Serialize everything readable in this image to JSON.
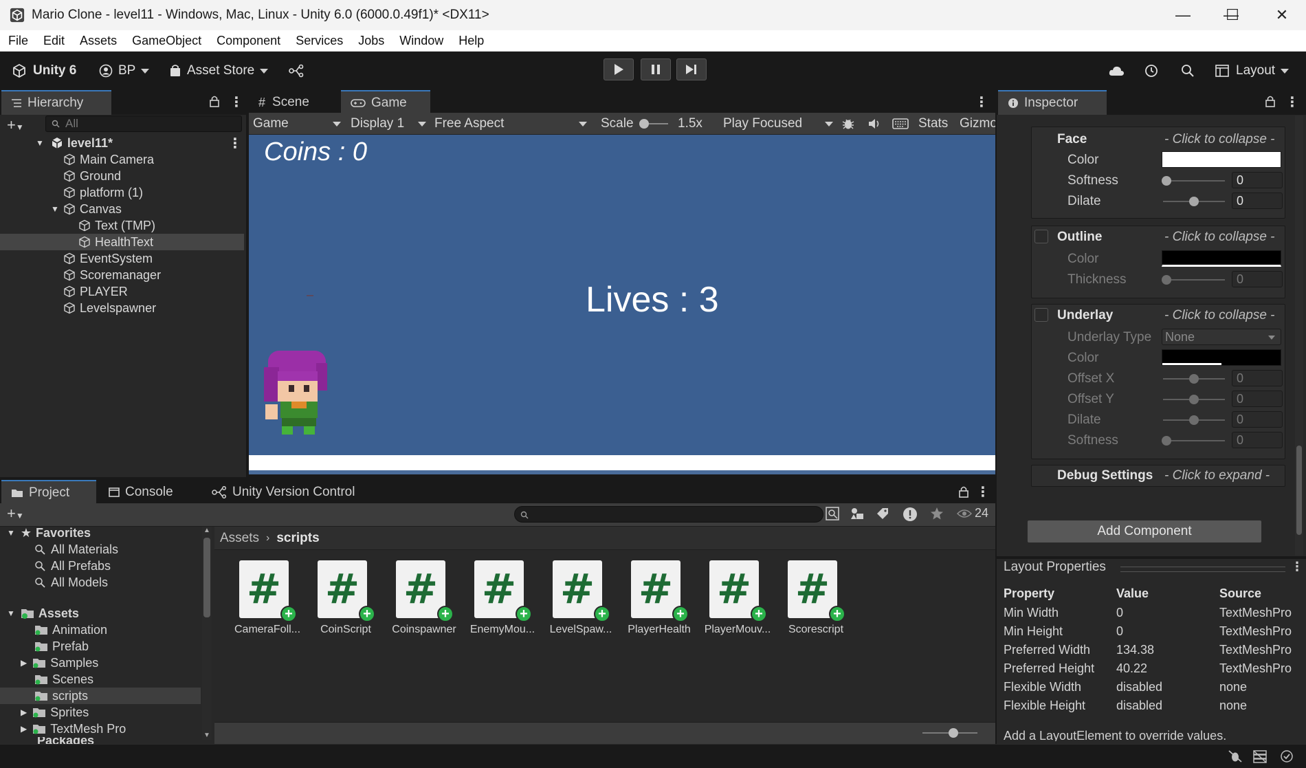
{
  "window": {
    "title": "Mario Clone - level11 - Windows, Mac, Linux - Unity 6.0 (6000.0.49f1)* <DX11>",
    "minimize": "—",
    "maximize": "☐",
    "close": "✕"
  },
  "menu": [
    "File",
    "Edit",
    "Assets",
    "GameObject",
    "Component",
    "Services",
    "Jobs",
    "Window",
    "Help"
  ],
  "toolbar": {
    "unity_label": "Unity 6",
    "account_label": "BP",
    "asset_store_label": "Asset Store",
    "layout_label": "Layout"
  },
  "hierarchy": {
    "tab_label": "Hierarchy",
    "search_placeholder": "All",
    "scene_name": "level11*",
    "items": [
      {
        "label": "Main Camera"
      },
      {
        "label": "Ground"
      },
      {
        "label": "platform (1)"
      },
      {
        "label": "Canvas"
      },
      {
        "label": "Text (TMP)"
      },
      {
        "label": "HealthText"
      },
      {
        "label": "EventSystem"
      },
      {
        "label": "Scoremanager"
      },
      {
        "label": "PLAYER"
      },
      {
        "label": "Levelspawner"
      }
    ]
  },
  "center_tabs": {
    "scene": "Scene",
    "game": "Game"
  },
  "game_toolbar": {
    "mode": "Game",
    "display": "Display 1",
    "aspect": "Free Aspect",
    "scale_label": "Scale",
    "scale_value": "1.5x",
    "play_mode": "Play Focused",
    "stats": "Stats",
    "gizmos": "Gizmo"
  },
  "game_view": {
    "coins_text": "Coins : 0",
    "lives_text": "Lives : 3"
  },
  "inspector": {
    "tab_label": "Inspector",
    "face": {
      "header": "Face",
      "hint": "- Click to collapse -",
      "color_label": "Color",
      "softness_label": "Softness",
      "softness_value": "0",
      "dilate_label": "Dilate",
      "dilate_value": "0"
    },
    "outline": {
      "header": "Outline",
      "hint": "- Click to collapse -",
      "color_label": "Color",
      "thickness_label": "Thickness",
      "thickness_value": "0"
    },
    "underlay": {
      "header": "Underlay",
      "hint": "- Click to collapse -",
      "type_label": "Underlay Type",
      "type_value": "None",
      "color_label": "Color",
      "offset_x_label": "Offset X",
      "offset_x_value": "0",
      "offset_y_label": "Offset Y",
      "offset_y_value": "0",
      "dilate_label": "Dilate",
      "dilate_value": "0",
      "softness_label": "Softness",
      "softness_value": "0"
    },
    "debug": {
      "header": "Debug Settings",
      "hint": "- Click to expand -"
    },
    "add_component": "Add Component"
  },
  "layout_properties": {
    "title": "Layout Properties",
    "headers": [
      "Property",
      "Value",
      "Source"
    ],
    "rows": [
      [
        "Min Width",
        "0",
        "TextMeshPro"
      ],
      [
        "Min Height",
        "0",
        "TextMeshPro"
      ],
      [
        "Preferred Width",
        "134.38",
        "TextMeshPro"
      ],
      [
        "Preferred Height",
        "40.22",
        "TextMeshPro"
      ],
      [
        "Flexible Width",
        "disabled",
        "none"
      ],
      [
        "Flexible Height",
        "disabled",
        "none"
      ]
    ],
    "footer": "Add a LayoutElement to override values."
  },
  "bottom_tabs": {
    "project": "Project",
    "console": "Console",
    "uvc": "Unity Version Control"
  },
  "project": {
    "hidden_count": "24",
    "favorites_label": "Favorites",
    "favorites": [
      "All Materials",
      "All Prefabs",
      "All Models"
    ],
    "assets_label": "Assets",
    "folders": [
      "Animation",
      "Prefab",
      "Samples",
      "Scenes",
      "scripts",
      "Sprites",
      "TextMesh Pro"
    ],
    "packages_label": "Packages",
    "breadcrumb_root": "Assets",
    "breadcrumb_current": "scripts",
    "scripts": [
      "CameraFoll...",
      "CoinScript",
      "Coinspawner",
      "EnemyMou...",
      "LevelSpaw...",
      "PlayerHealth",
      "PlayerMouv...",
      "Scorescript"
    ]
  },
  "colors": {
    "game_background": "#3b5f91",
    "accent_blue": "#3a79bb",
    "script_green": "#1e6b34"
  }
}
